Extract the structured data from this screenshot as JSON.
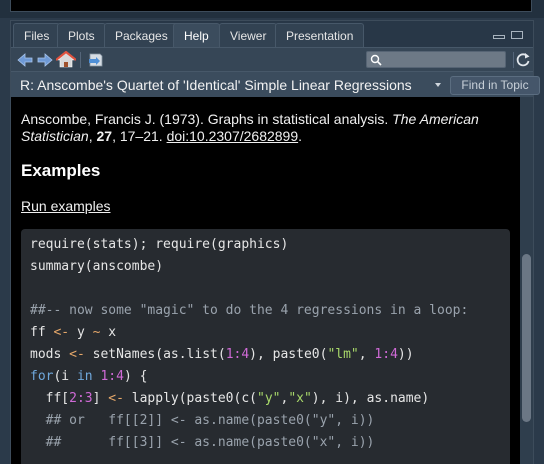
{
  "tabs": [
    "Files",
    "Plots",
    "Packages",
    "Help",
    "Viewer",
    "Presentation"
  ],
  "active_tab": "Help",
  "toolbar": {
    "icons": [
      "arrow-left-icon",
      "arrow-right-icon",
      "home-icon",
      "print-icon"
    ],
    "search_value": "",
    "refresh_icon": "refresh-icon"
  },
  "topic": {
    "title": "R: Anscombe's Quartet of 'Identical' Simple Linear Regressions",
    "find_label": "Find in Topic"
  },
  "reference": {
    "authors": "Anscombe, Francis J. (1973). Graphs in statistical analysis.",
    "journal": "The American Statistician",
    "volume": "27",
    "pages": ", 17–21.",
    "doi": "doi:10.2307/2682899"
  },
  "examples_heading": "Examples",
  "run_examples": "Run examples",
  "colors": {
    "pane_bg": "#2f3e4d",
    "content_bg": "#000000",
    "code_bg": "#272b30",
    "keyword": "#6fa8dc",
    "number": "#cf6ad6",
    "string": "#a8d86a",
    "operator": "#e6a86a"
  },
  "code_lines": [
    [
      [
        "t",
        "require(stats); require(graphics)"
      ]
    ],
    [
      [
        "t",
        "summary(anscombe)"
      ]
    ],
    [
      [
        "t",
        ""
      ]
    ],
    [
      [
        "c",
        "##-- now some \"magic\" to do the 4 regressions in a loop:"
      ]
    ],
    [
      [
        "t",
        "ff "
      ],
      [
        "o",
        "<-"
      ],
      [
        "t",
        " y "
      ],
      [
        "o",
        "~"
      ],
      [
        "t",
        " x"
      ]
    ],
    [
      [
        "t",
        "mods "
      ],
      [
        "o",
        "<-"
      ],
      [
        "t",
        " setNames(as.list("
      ],
      [
        "n",
        "1:4"
      ],
      [
        "t",
        "), paste0("
      ],
      [
        "s",
        "\"lm\""
      ],
      [
        "t",
        ", "
      ],
      [
        "n",
        "1:4"
      ],
      [
        "t",
        "))"
      ]
    ],
    [
      [
        "k",
        "for"
      ],
      [
        "t",
        "(i "
      ],
      [
        "k",
        "in"
      ],
      [
        "t",
        " "
      ],
      [
        "n",
        "1:4"
      ],
      [
        "t",
        ") {"
      ]
    ],
    [
      [
        "t",
        "  ff["
      ],
      [
        "n",
        "2:3"
      ],
      [
        "t",
        "] "
      ],
      [
        "o",
        "<-"
      ],
      [
        "t",
        " lapply(paste0(c("
      ],
      [
        "s",
        "\"y\""
      ],
      [
        "t",
        ","
      ],
      [
        "s",
        "\"x\""
      ],
      [
        "t",
        "), i), as.name)"
      ]
    ],
    [
      [
        "c",
        "  ## or   ff[[2]] <- as.name(paste0(\"y\", i))"
      ]
    ],
    [
      [
        "c",
        "  ##      ff[[3]] <- as.name(paste0(\"x\", i))"
      ]
    ]
  ]
}
